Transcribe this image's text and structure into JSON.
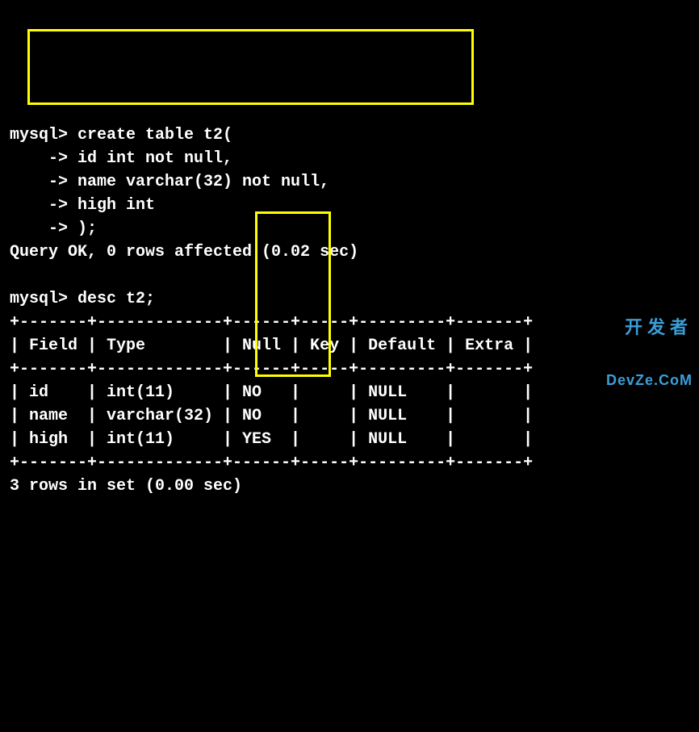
{
  "prompt": "mysql>",
  "cont_prompt": "    ->",
  "create": {
    "cmd": " create table t2(",
    "l1": " id int not null,",
    "l2": " name varchar(32) not null,",
    "l3": " high int",
    "l4": " );"
  },
  "create_result": "Query OK, 0 rows affected (0.02 sec)",
  "blank": "",
  "desc_cmd": " desc t2;",
  "table": {
    "border": "+-------+-------------+------+-----+---------+-------+",
    "header": "| Field | Type        | Null | Key | Default | Extra |",
    "rows": [
      "| id    | int(11)     | NO   |     | NULL    |       |",
      "| name  | varchar(32) | NO   |     | NULL    |       |",
      "| high  | int(11)     | YES  |     | NULL    |       |"
    ]
  },
  "desc_result": "3 rows in set (0.00 sec)",
  "watermark": {
    "cn": "开发者",
    "en": "DevZe.CoM"
  }
}
